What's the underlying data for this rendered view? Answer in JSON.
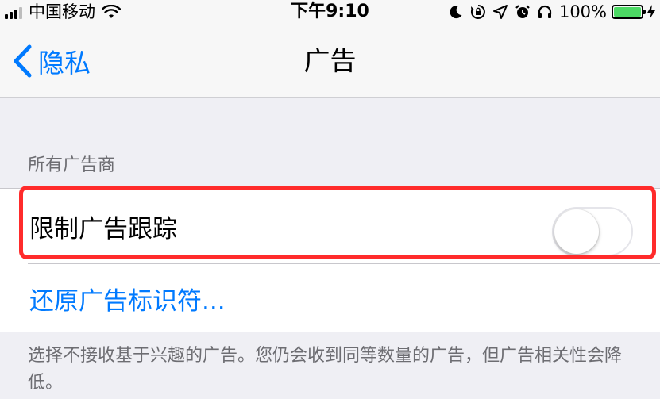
{
  "status_bar": {
    "carrier": "中国移动",
    "time": "下午9:10",
    "battery": "100%",
    "battery_level": 1.0
  },
  "nav": {
    "back_label": "隐私",
    "title": "广告"
  },
  "section": {
    "header": "所有广告商",
    "limit_tracking_label": "限制广告跟踪",
    "limit_tracking_on": false,
    "reset_label": "还原广告标识符...",
    "footer": "选择不接收基于兴趣的广告。您仍会收到同等数量的广告，但广告相关性会降低。"
  },
  "colors": {
    "accent": "#007aff",
    "highlight": "#ff2b2b",
    "battery": "#4cd964"
  },
  "icons": [
    "cellular-signal-icon",
    "wifi-icon",
    "moon-icon",
    "rotation-lock-icon",
    "location-icon",
    "alarm-icon",
    "headphones-icon",
    "battery-icon",
    "charging-bolt-icon",
    "chevron-left-icon"
  ]
}
